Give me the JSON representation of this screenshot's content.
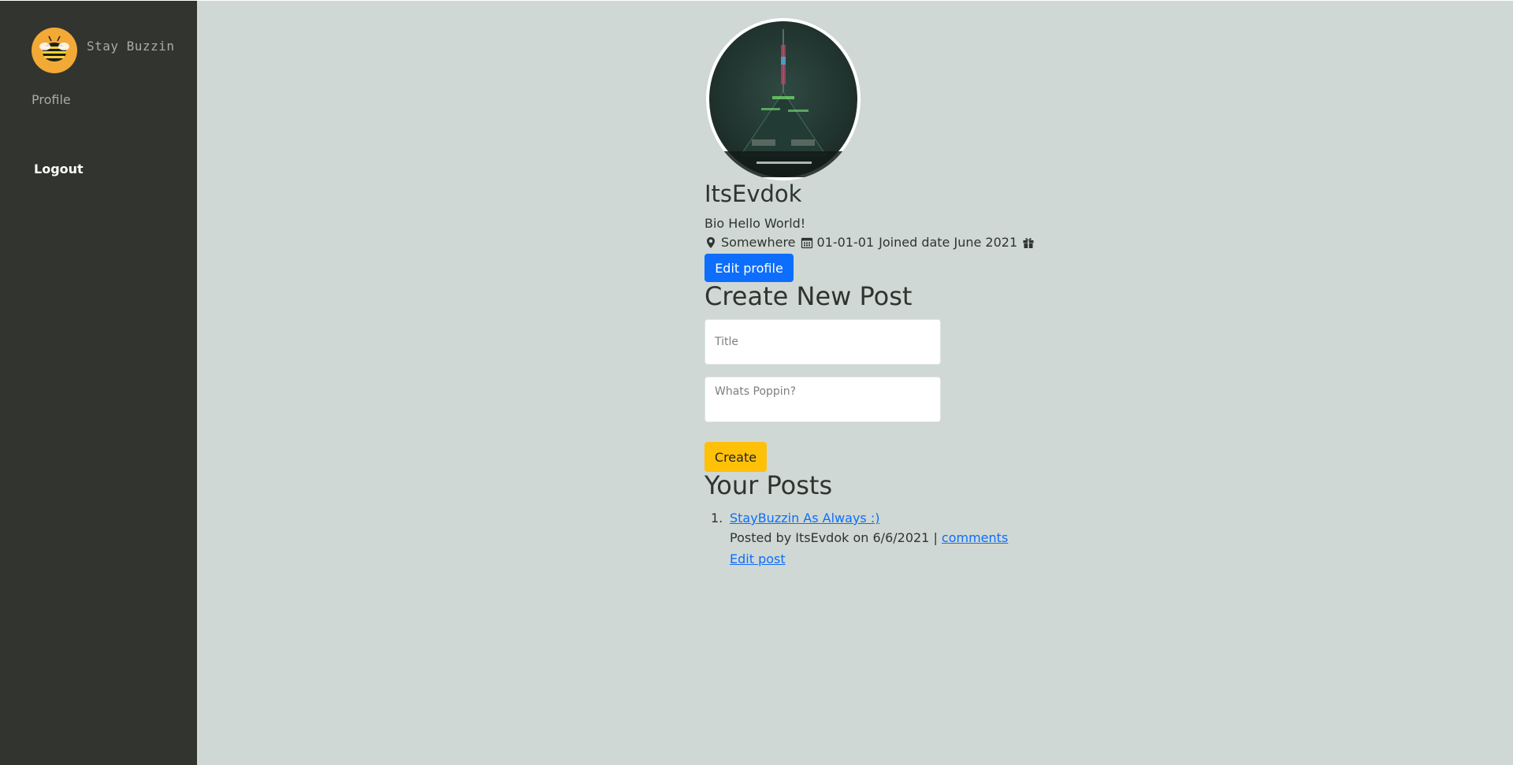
{
  "sidebar": {
    "brand_name": "Stay Buzzin",
    "nav_profile": "Profile",
    "logout": "Logout"
  },
  "profile": {
    "username": "ItsEvdok",
    "bio": "Bio Hello World!",
    "location": "Somewhere",
    "birthday": "01-01-01",
    "joined": "Joined date June 2021",
    "edit_button": "Edit profile"
  },
  "create_post": {
    "heading": "Create New Post",
    "title_placeholder": "Title",
    "body_placeholder": "Whats Poppin?",
    "create_button": "Create"
  },
  "posts": {
    "heading": "Your Posts",
    "items": [
      {
        "number": "1.",
        "title": "StayBuzzin As Always :)",
        "byline_prefix": "Posted by ItsEvdok on 6/6/2021 |",
        "comments_link": "comments",
        "edit_link": "Edit post"
      }
    ]
  },
  "colors": {
    "background": "#cfd8d4",
    "sidebar": "#323430",
    "primary": "#0d6efd",
    "warning": "#ffc107",
    "logo": "#f2a935"
  },
  "icons": {
    "location": "map-marker-icon",
    "calendar": "calendar-icon",
    "gift": "gift-icon",
    "logo": "bee-icon"
  }
}
